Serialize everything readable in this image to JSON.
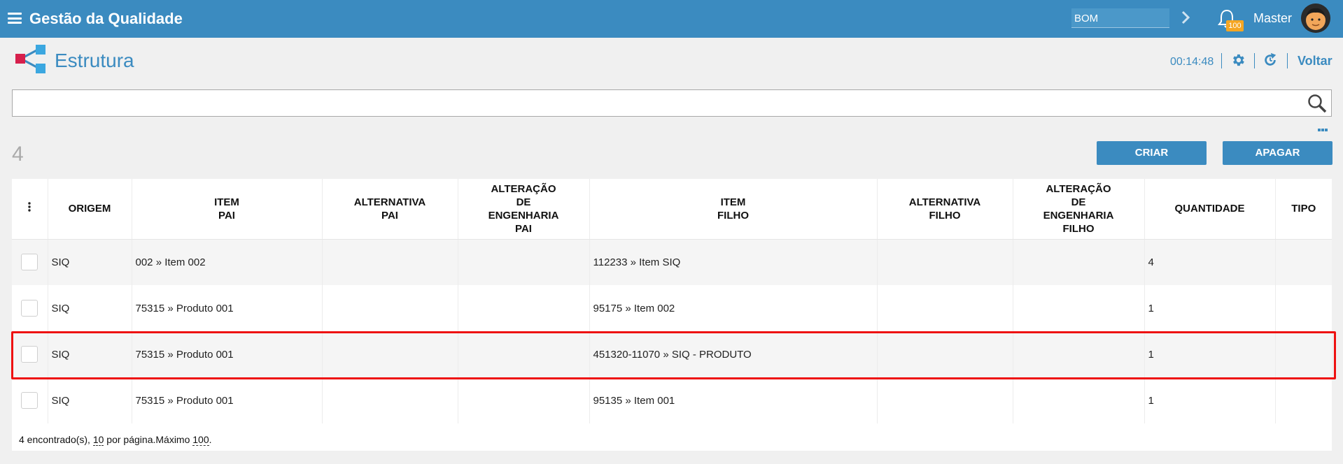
{
  "header": {
    "app_title": "Gestão da Qualidade",
    "module_value": "BOM",
    "notification_count": "100",
    "user_name": "Master",
    "brand_color": "#3b8bc0"
  },
  "page": {
    "title": "Estrutura",
    "clock": "00:14:48",
    "back_label": "Voltar",
    "icons": [
      "structure-icon",
      "gear-icon",
      "refresh-icon",
      "search-icon"
    ]
  },
  "search": {
    "value": "",
    "placeholder": ""
  },
  "toolbar": {
    "record_count": "4",
    "create_label": "CRIAR",
    "delete_label": "APAGAR"
  },
  "table": {
    "columns": [
      [
        "ORIGEM"
      ],
      [
        "ITEM",
        "PAI"
      ],
      [
        "ALTERNATIVA",
        "PAI"
      ],
      [
        "ALTERAÇÃO",
        "DE",
        "ENGENHARIA",
        "PAI"
      ],
      [
        "ITEM",
        "FILHO"
      ],
      [
        "ALTERNATIVA",
        "FILHO"
      ],
      [
        "ALTERAÇÃO",
        "DE",
        "ENGENHARIA",
        "FILHO"
      ],
      [
        "QUANTIDADE"
      ],
      [
        "TIPO"
      ]
    ],
    "rows": [
      [
        "SIQ",
        "002 » Item 002",
        "",
        "",
        "112233 » Item SIQ",
        "",
        "",
        "4",
        ""
      ],
      [
        "SIQ",
        "75315 » Produto 001",
        "",
        "",
        "95175 » Item 002",
        "",
        "",
        "1",
        ""
      ],
      [
        "SIQ",
        "75315 » Produto 001",
        "",
        "",
        "451320-11070 » SIQ - PRODUTO",
        "",
        "",
        "1",
        ""
      ],
      [
        "SIQ",
        "75315 » Produto 001",
        "",
        "",
        "95135 » Item 001",
        "",
        "",
        "1",
        ""
      ]
    ],
    "highlighted_row": 3
  },
  "footer": {
    "found_text": "4 encontrado(s), ",
    "per_page": "10",
    "per_page_text": " por página.Máximo ",
    "max": "100",
    "end": "."
  }
}
